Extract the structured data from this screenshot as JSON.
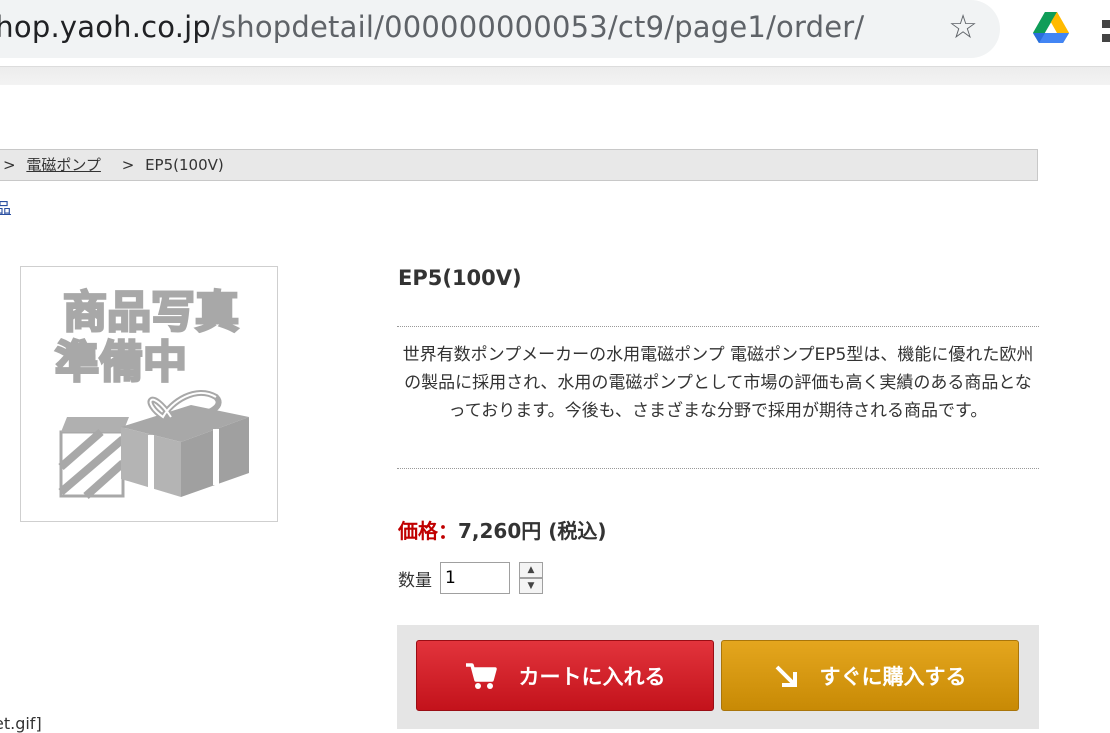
{
  "browser": {
    "url_host": "shop.yaoh.co.jp",
    "url_path": "/shopdetail/000000000053/ct9/page1/order/",
    "icons": [
      "star-icon",
      "google-drive-icon",
      "extension-icon"
    ]
  },
  "breadcrumb": {
    "sep1": ">",
    "category": "電磁ポンプ",
    "sep2": ">",
    "current": "EP5(100V)"
  },
  "category_link": "品",
  "product": {
    "image_text_line1": "商品写真",
    "image_text_line2": "準備中",
    "title": "EP5(100V)",
    "description": "世界有数ポンプメーカーの水用電磁ポンプ 電磁ポンプEP5型は、機能に優れた欧州の製品に採用され、水用の電磁ポンプとして市場の評価も高く実績のある商品となっております。今後も、さまざまな分野で採用が期待される商品です。",
    "price_label": "価格：",
    "price_value": "7,260円 (税込)",
    "qty_label": "数量",
    "qty_value": "1"
  },
  "buttons": {
    "cart_label": "カートに入れる",
    "buy_label": "すぐに購入する"
  },
  "stray_text": "et.gif]",
  "colors": {
    "price_label": "#c00000",
    "cart_button": "#d1222a",
    "buy_button": "#d69812",
    "link": "#2a4fa0"
  }
}
